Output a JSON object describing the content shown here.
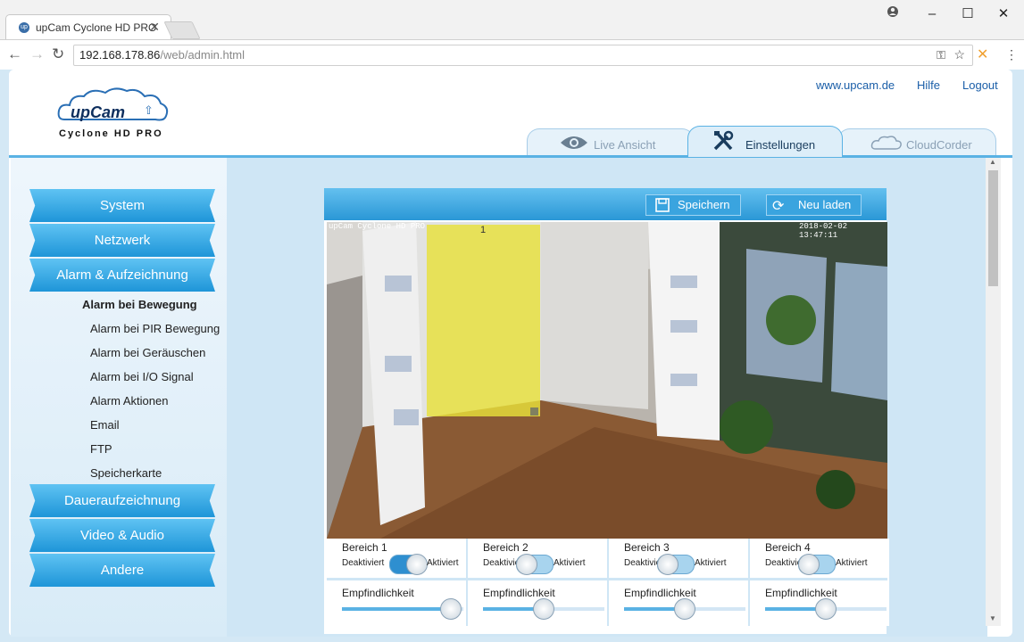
{
  "browser": {
    "tab_title": "upCam Cyclone HD PRO",
    "tab_close": "✕",
    "url_host": "192.168.178.86",
    "url_path": "/web/admin.html",
    "window_buttons": {
      "minimize": "–",
      "maximize": "☐",
      "close": "✕"
    }
  },
  "header": {
    "logo_text": "upCam",
    "logo_sub": "Cyclone HD PRO",
    "links": {
      "site": "www.upcam.de",
      "help": "Hilfe",
      "logout": "Logout"
    },
    "tabs": {
      "live": "Live Ansicht",
      "settings": "Einstellungen",
      "cloud": "CloudCorder"
    }
  },
  "nav": {
    "system": "System",
    "network": "Netzwerk",
    "alarm": "Alarm & Aufzeichnung",
    "sub": [
      "Alarm bei Bewegung",
      "Alarm bei PIR Bewegung",
      "Alarm bei Geräuschen",
      "Alarm bei I/O Signal",
      "Alarm Aktionen",
      "Email",
      "FTP",
      "Speicherkarte"
    ],
    "continuous": "Daueraufzeichnung",
    "video_audio": "Video & Audio",
    "other": "Andere"
  },
  "panel": {
    "save": "Speichern",
    "reload": "Neu laden",
    "overlay_cam": "upCam Cyclone HD PRO",
    "overlay_time": "2018-02-02 13:47:11",
    "zone_number": "1",
    "areas": [
      {
        "title": "Bereich 1",
        "off": "Deaktiviert",
        "on": "Aktiviert",
        "enabled": true,
        "sens_label": "Empfindlichkeit",
        "sensitivity": 0.9
      },
      {
        "title": "Bereich 2",
        "off": "Deaktiviert",
        "on": "Aktiviert",
        "enabled": false,
        "sens_label": "Empfindlichkeit",
        "sensitivity": 0.5
      },
      {
        "title": "Bereich 3",
        "off": "Deaktiviert",
        "on": "Aktiviert",
        "enabled": false,
        "sens_label": "Empfindlichkeit",
        "sensitivity": 0.5
      },
      {
        "title": "Bereich 4",
        "off": "Deaktiviert",
        "on": "Aktiviert",
        "enabled": false,
        "sens_label": "Empfindlichkeit",
        "sensitivity": 0.5
      }
    ]
  },
  "colors": {
    "accent": "#2a97d6",
    "zone": "#e8e03a"
  }
}
